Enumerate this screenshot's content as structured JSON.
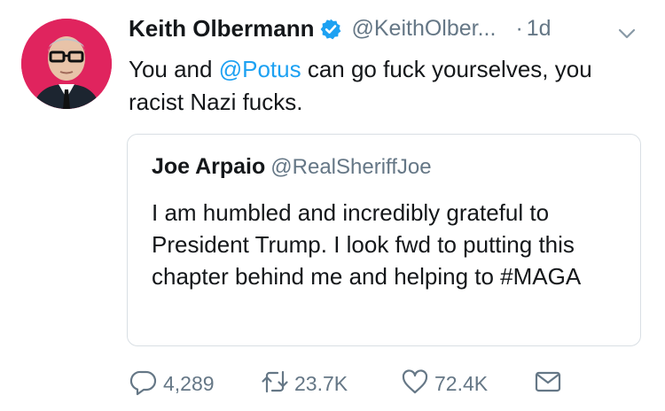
{
  "tweet": {
    "author_name": "Keith Olbermann",
    "author_handle": "@KeithOlber...",
    "dot": "·",
    "time": "1d",
    "text_before": "You and ",
    "mention": "@Potus",
    "text_after": " can go fuck yourselves, you racist Nazi fucks."
  },
  "quoted": {
    "author_name": "Joe Arpaio",
    "author_handle": "@RealSheriffJoe",
    "text": "I am humbled and incredibly grateful to President Trump. I look fwd to putting this chapter behind me and helping to #MAGA"
  },
  "actions": {
    "replies": "4,289",
    "retweets": "23.7K",
    "likes": "72.4K"
  },
  "icons": [
    "verified-icon",
    "chevron-down-icon",
    "reply-icon",
    "retweet-icon",
    "like-icon",
    "message-icon"
  ],
  "colors": {
    "link": "#1da1f2",
    "secondary_text": "#657786",
    "border": "#d9dfe4",
    "avatar_bg": "#e0245e"
  }
}
